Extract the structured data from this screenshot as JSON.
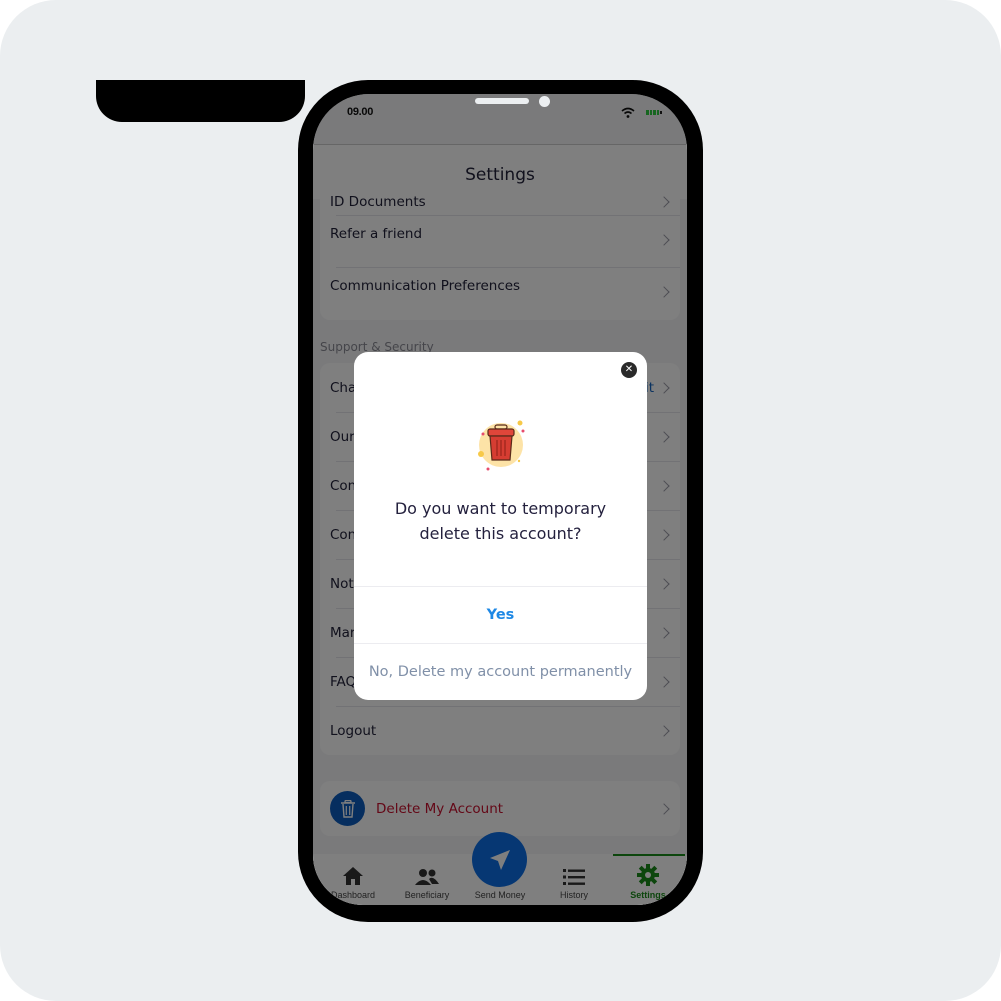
{
  "status_bar": {
    "time": "09.00",
    "wifi_icon": "wifi-icon",
    "battery_icon": "battery-icon"
  },
  "header": {
    "title": "Settings"
  },
  "settings": {
    "top_group": {
      "items": [
        {
          "label": "ID Documents"
        },
        {
          "label": "Refer a friend"
        },
        {
          "label": "Communication Preferences"
        }
      ]
    },
    "support_section_label": "Support & Security",
    "support_group": {
      "items": [
        {
          "label": "Change Password",
          "visible_prefix": "Cha",
          "action": "Edit"
        },
        {
          "label": "Our",
          "visible_prefix": "Our"
        },
        {
          "label": "Con",
          "visible_prefix": "Con"
        },
        {
          "label": "Con",
          "visible_prefix": "Con"
        },
        {
          "label": "Not",
          "visible_prefix": "Not"
        },
        {
          "label": "Mar",
          "visible_prefix": "Mar"
        },
        {
          "label": "FAQ",
          "visible_prefix": "FAQ"
        },
        {
          "label": "Logout",
          "visible_prefix": "Logout"
        }
      ]
    },
    "delete_account": {
      "label": "Delete My Account",
      "icon": "trash-icon"
    }
  },
  "tabbar": {
    "tabs": [
      {
        "label": "Dashboard",
        "icon": "home-icon",
        "active": false
      },
      {
        "label": "Beneficiary",
        "icon": "users-icon",
        "active": false
      },
      {
        "label": "Send Money",
        "icon": "paper-plane-icon",
        "active": false
      },
      {
        "label": "History",
        "icon": "list-icon",
        "active": false
      },
      {
        "label": "Settings",
        "icon": "gear-icon",
        "active": true
      }
    ]
  },
  "modal": {
    "illustration": "trash-can-icon",
    "question_line1": "Do you want to temporary",
    "question_line2": "delete this account?",
    "yes_label": "Yes",
    "no_label": "No, Delete my account permanently",
    "close_icon": "close-icon"
  },
  "colors": {
    "accent_blue": "#1e88e5",
    "active_green": "#1a8c1a",
    "danger_red": "#c8102e",
    "fab_blue": "#0d6fe6"
  }
}
